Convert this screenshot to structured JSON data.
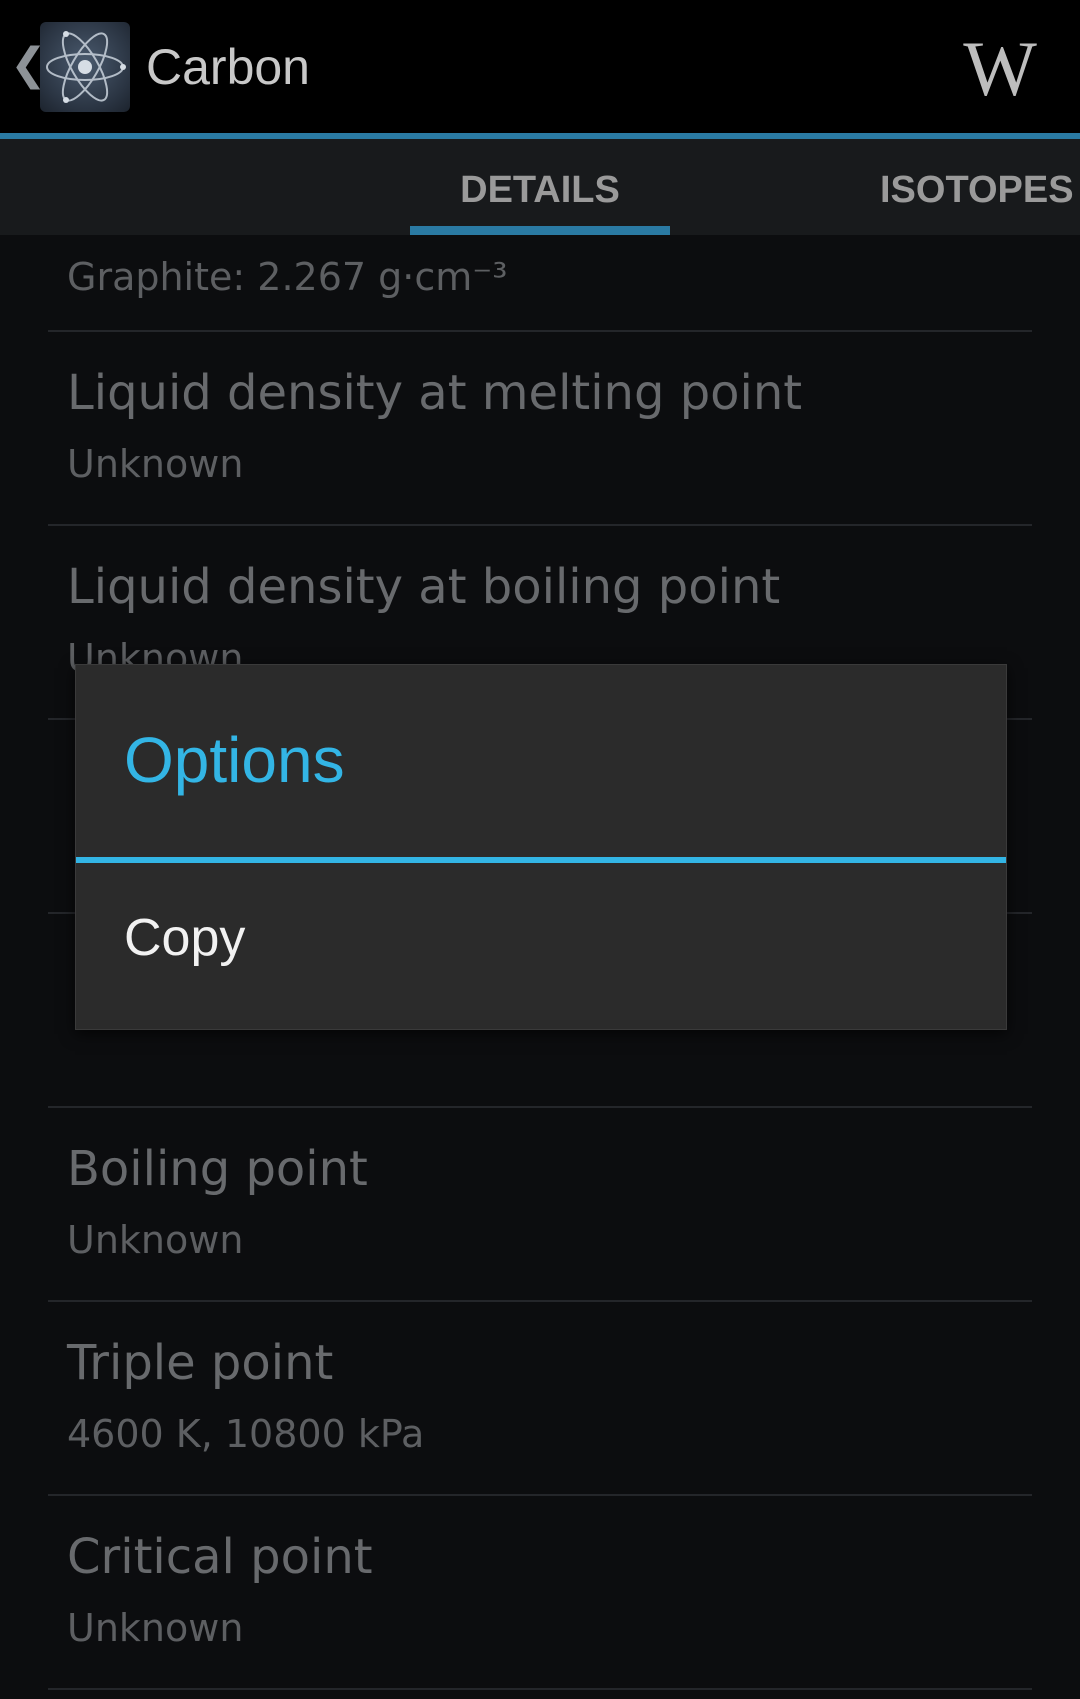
{
  "app": {
    "title": "Carbon",
    "up_glyph": "❮",
    "wiki_glyph": "W",
    "icons": {
      "app": "atom-icon",
      "wiki": "wikipedia-icon"
    }
  },
  "tabs": [
    {
      "label": "DETAILS",
      "selected": true
    },
    {
      "label": "ISOTOPES",
      "selected": false
    }
  ],
  "properties": [
    {
      "label": "",
      "value": "Graphite: 2.267 g·cm⁻³"
    },
    {
      "label": "Liquid density at melting point",
      "value": "Unknown"
    },
    {
      "label": "Liquid density at boiling point",
      "value": "Unknown"
    },
    {
      "label": "",
      "value": ""
    },
    {
      "label": "",
      "value": ""
    },
    {
      "label": "Boiling point",
      "value": "Unknown"
    },
    {
      "label": "Triple point",
      "value": "4600 K, 10800 kPa"
    },
    {
      "label": "Critical point",
      "value": "Unknown"
    }
  ],
  "dialog": {
    "title": "Options",
    "items": [
      {
        "label": "Copy"
      }
    ]
  },
  "colors": {
    "accent": "#33b5e5",
    "actionbar": "#000000",
    "tab_indicator": "#2a7aa3",
    "dialog_bg": "#2b2b2b"
  }
}
